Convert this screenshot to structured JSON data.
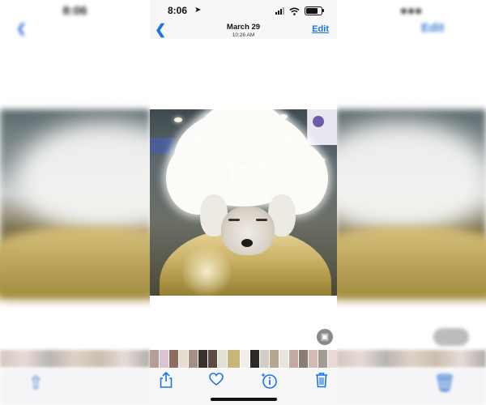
{
  "status_bar": {
    "time": "8:06",
    "location_icon": "navigation-arrow-icon",
    "signal_icon": "cellular-signal-icon",
    "wifi_icon": "wifi-icon",
    "battery_icon": "battery-icon",
    "battery_level": 0.8
  },
  "nav": {
    "back_icon": "chevron-left-icon",
    "date": "March 29",
    "time": "10:26 AM",
    "edit_label": "Edit"
  },
  "photo": {
    "subject_icon": "poodle-photo",
    "scan_icon": "live-text-icon"
  },
  "toolbar": {
    "share_icon": "share-icon",
    "favorite_icon": "heart-icon",
    "info_icon": "info-sparkle-icon",
    "delete_icon": "trash-icon"
  },
  "colors": {
    "accent": "#1a73e8",
    "bar_background": "#f7f7f7"
  }
}
